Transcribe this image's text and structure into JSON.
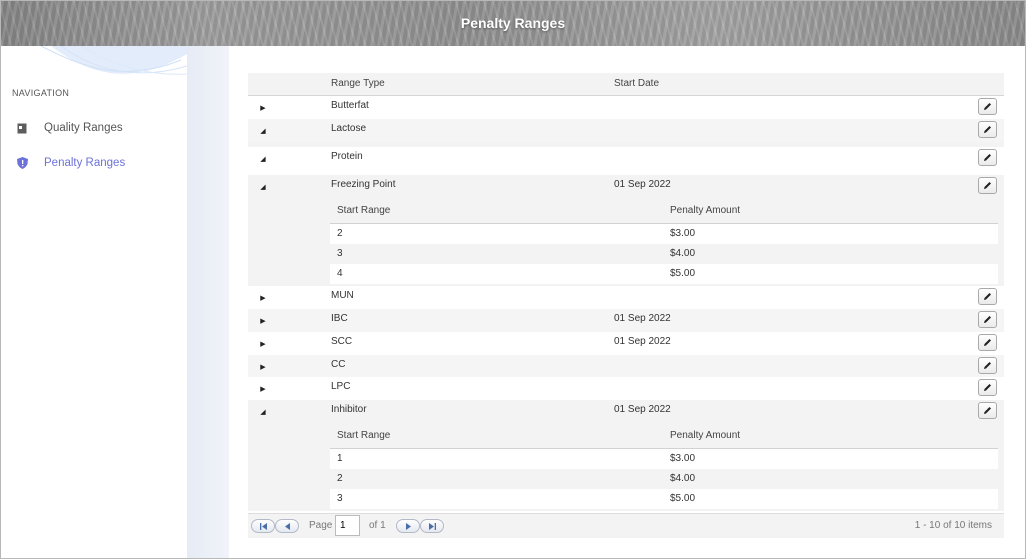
{
  "header": {
    "title": "Penalty Ranges"
  },
  "sidebar": {
    "heading": "NAVIGATION",
    "items": [
      {
        "label": "Quality Ranges",
        "icon": "quality-icon",
        "active": false
      },
      {
        "label": "Penalty Ranges",
        "icon": "shield-alert-icon",
        "active": true
      }
    ]
  },
  "grid": {
    "columns": {
      "range_type": "Range Type",
      "start_date": "Start Date"
    },
    "rows": [
      {
        "range_type": "Butterfat",
        "start_date": "",
        "expanded": false
      },
      {
        "range_type": "Lactose",
        "start_date": "",
        "expanded": true
      },
      {
        "range_type": "Protein",
        "start_date": "",
        "expanded": true
      },
      {
        "range_type": "Freezing Point",
        "start_date": "01 Sep 2022",
        "expanded": true
      },
      {
        "range_type": "MUN",
        "start_date": "",
        "expanded": false
      },
      {
        "range_type": "IBC",
        "start_date": "01 Sep 2022",
        "expanded": false
      },
      {
        "range_type": "SCC",
        "start_date": "01 Sep 2022",
        "expanded": false
      },
      {
        "range_type": "CC",
        "start_date": "",
        "expanded": false
      },
      {
        "range_type": "LPC",
        "start_date": "",
        "expanded": false
      },
      {
        "range_type": "Inhibitor",
        "start_date": "01 Sep 2022",
        "expanded": true
      }
    ],
    "detail_columns": {
      "start_range": "Start Range",
      "penalty_amount": "Penalty Amount"
    },
    "freezing_point_detail": [
      {
        "start_range": "2",
        "penalty_amount": "$3.00"
      },
      {
        "start_range": "3",
        "penalty_amount": "$4.00"
      },
      {
        "start_range": "4",
        "penalty_amount": "$5.00"
      }
    ],
    "inhibitor_detail": [
      {
        "start_range": "1",
        "penalty_amount": "$3.00"
      },
      {
        "start_range": "2",
        "penalty_amount": "$4.00"
      },
      {
        "start_range": "3",
        "penalty_amount": "$5.00"
      }
    ]
  },
  "pager": {
    "page_label": "Page",
    "page_value": "1",
    "of_label": "of 1",
    "summary": "1 - 10 of 10 items"
  },
  "colors": {
    "accent": "#6d72d8",
    "header_bg": "#9a9a9a"
  }
}
